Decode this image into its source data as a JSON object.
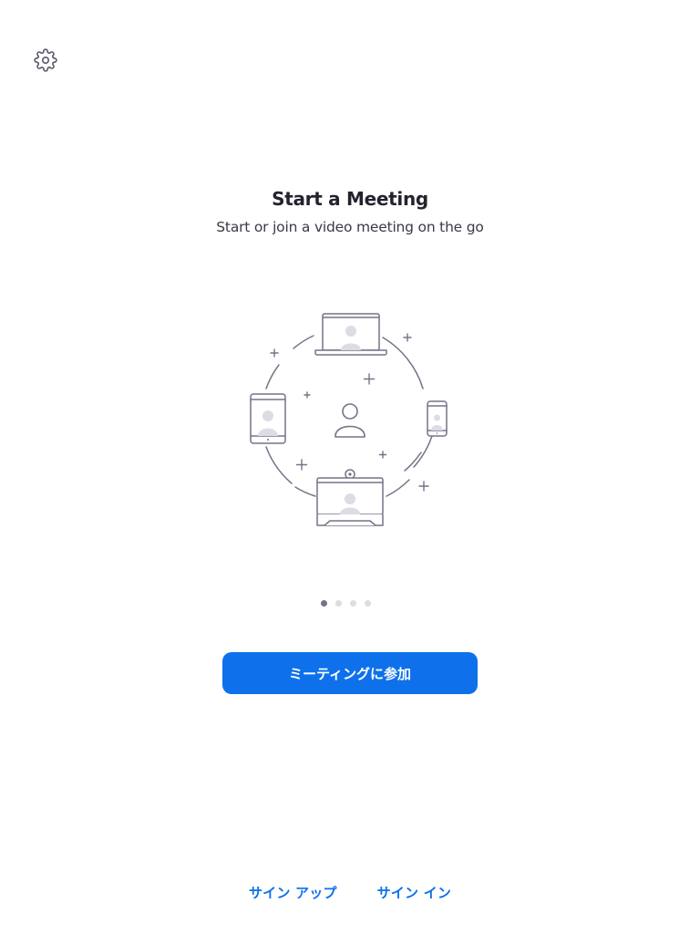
{
  "header": {
    "settings_icon": "gear-icon"
  },
  "onboarding": {
    "title": "Start a Meeting",
    "subtitle": "Start or join a video meeting on the go",
    "illustration_icon": "meeting-devices-illustration",
    "pager": {
      "total": 4,
      "current": 1
    }
  },
  "actions": {
    "join_meeting_label": "ミーティングに参加",
    "sign_up_label": "サイン アップ",
    "sign_in_label": "サイン イン"
  },
  "colors": {
    "accent": "#0e71eb",
    "title_text": "#23232e",
    "body_text": "#3a3a48",
    "dot_active": "#747487",
    "dot_inactive": "#dcdce2"
  }
}
